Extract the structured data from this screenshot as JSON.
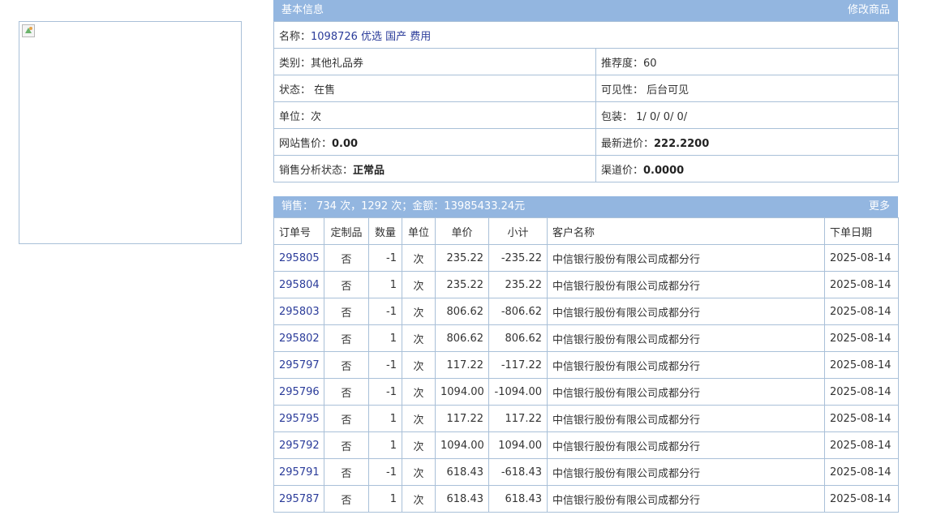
{
  "info": {
    "title": "基本信息",
    "edit_link": "修改商品",
    "name_label": "名称：",
    "name_value": "1098726 优选 国产 费用",
    "category_label": "类别：",
    "category_value": "其他礼品券",
    "recommend_label": "推荐度：",
    "recommend_value": "60",
    "status_label": "状态：",
    "status_value": "在售",
    "visibility_label": "可见性：",
    "visibility_value": "后台可见",
    "unit_label": "单位：",
    "unit_value": "次",
    "package_label": "包装：",
    "package_value": "1/ 0/ 0/ 0/",
    "site_price_label": "网站售价：",
    "site_price_value": "0.00",
    "latest_cost_label": "最新进价：",
    "latest_cost_value": "222.2200",
    "sales_status_label": "销售分析状态：",
    "sales_status_value": "正常品",
    "channel_price_label": "渠道价：",
    "channel_price_value": "0.0000"
  },
  "sales": {
    "summary": "销售：  734 次，1292 次；金额：13985433.24元",
    "more_link": "更多",
    "columns": [
      "订单号",
      "定制品",
      "数量",
      "单位",
      "单价",
      "小计",
      "客户名称",
      "下单日期"
    ],
    "rows": [
      {
        "order": "295805",
        "custom": "否",
        "qty": "-1",
        "unit": "次",
        "price": "235.22",
        "subtotal": "-235.22",
        "customer": "中信银行股份有限公司成都分行",
        "date": "2025-08-14"
      },
      {
        "order": "295804",
        "custom": "否",
        "qty": "1",
        "unit": "次",
        "price": "235.22",
        "subtotal": "235.22",
        "customer": "中信银行股份有限公司成都分行",
        "date": "2025-08-14"
      },
      {
        "order": "295803",
        "custom": "否",
        "qty": "-1",
        "unit": "次",
        "price": "806.62",
        "subtotal": "-806.62",
        "customer": "中信银行股份有限公司成都分行",
        "date": "2025-08-14"
      },
      {
        "order": "295802",
        "custom": "否",
        "qty": "1",
        "unit": "次",
        "price": "806.62",
        "subtotal": "806.62",
        "customer": "中信银行股份有限公司成都分行",
        "date": "2025-08-14"
      },
      {
        "order": "295797",
        "custom": "否",
        "qty": "-1",
        "unit": "次",
        "price": "117.22",
        "subtotal": "-117.22",
        "customer": "中信银行股份有限公司成都分行",
        "date": "2025-08-14"
      },
      {
        "order": "295796",
        "custom": "否",
        "qty": "-1",
        "unit": "次",
        "price": "1094.00",
        "subtotal": "-1094.00",
        "customer": "中信银行股份有限公司成都分行",
        "date": "2025-08-14"
      },
      {
        "order": "295795",
        "custom": "否",
        "qty": "1",
        "unit": "次",
        "price": "117.22",
        "subtotal": "117.22",
        "customer": "中信银行股份有限公司成都分行",
        "date": "2025-08-14"
      },
      {
        "order": "295792",
        "custom": "否",
        "qty": "1",
        "unit": "次",
        "price": "1094.00",
        "subtotal": "1094.00",
        "customer": "中信银行股份有限公司成都分行",
        "date": "2025-08-14"
      },
      {
        "order": "295791",
        "custom": "否",
        "qty": "-1",
        "unit": "次",
        "price": "618.43",
        "subtotal": "-618.43",
        "customer": "中信银行股份有限公司成都分行",
        "date": "2025-08-14"
      },
      {
        "order": "295787",
        "custom": "否",
        "qty": "1",
        "unit": "次",
        "price": "618.43",
        "subtotal": "618.43",
        "customer": "中信银行股份有限公司成都分行",
        "date": "2025-08-14"
      }
    ]
  },
  "colors": {
    "header_bg": "#93b6e0",
    "border": "#a9c0d8",
    "link": "#2b3c9a"
  }
}
